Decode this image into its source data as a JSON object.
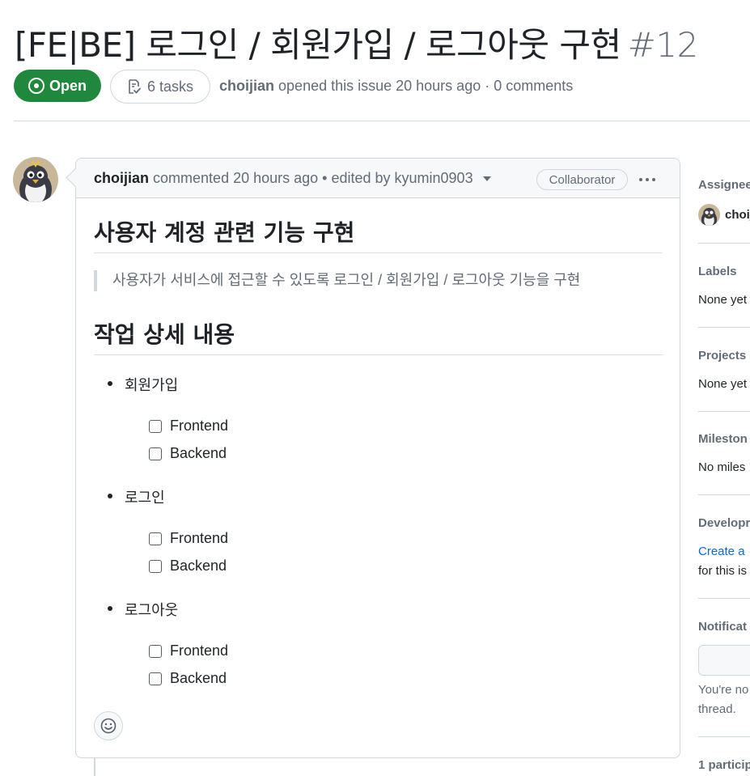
{
  "issue": {
    "title": "[FE|BE] 로그인 / 회원가입 / 로그아웃 구현",
    "number": "#12",
    "state": "Open",
    "tasks_label": "6 tasks",
    "author": "choijian",
    "meta": "opened this issue 20 hours ago · 0 comments"
  },
  "comment": {
    "author": "choijian",
    "meta": "commented 20 hours ago • edited by kyumin0903",
    "role": "Collaborator",
    "heading": "사용자 계정 관련 기능 구현",
    "quote": "사용자가 서비스에 접근할 수 있도록 로그인 / 회원가입 / 로그아웃 기능을 구현",
    "subheading": "작업 상세 내용",
    "sections": [
      {
        "label": "회원가입",
        "tasks": [
          "Frontend",
          "Backend"
        ]
      },
      {
        "label": "로그인",
        "tasks": [
          "Frontend",
          "Backend"
        ]
      },
      {
        "label": "로그아웃",
        "tasks": [
          "Frontend",
          "Backend"
        ]
      }
    ]
  },
  "sidebar": {
    "assignees_title": "Assignee",
    "assignee_name": "choij",
    "labels_title": "Labels",
    "labels_value": "None yet",
    "projects_title": "Projects",
    "projects_value": "None yet",
    "milestone_title": "Mileston",
    "milestone_value": "No miles",
    "development_title": "Developr",
    "development_link": "Create a",
    "development_text": "for this is",
    "notifications_title": "Notificat",
    "notifications_line1": "You're no",
    "notifications_line2": "thread.",
    "participants_title": "1 particip"
  },
  "colors": {
    "open_green": "#1f883d",
    "link_blue": "#0969da",
    "muted": "#636c76",
    "border": "#d0d7de"
  },
  "icons": [
    "issue-open-icon",
    "tasklist-icon",
    "caret-down-icon",
    "kebab-icon",
    "smiley-icon"
  ]
}
